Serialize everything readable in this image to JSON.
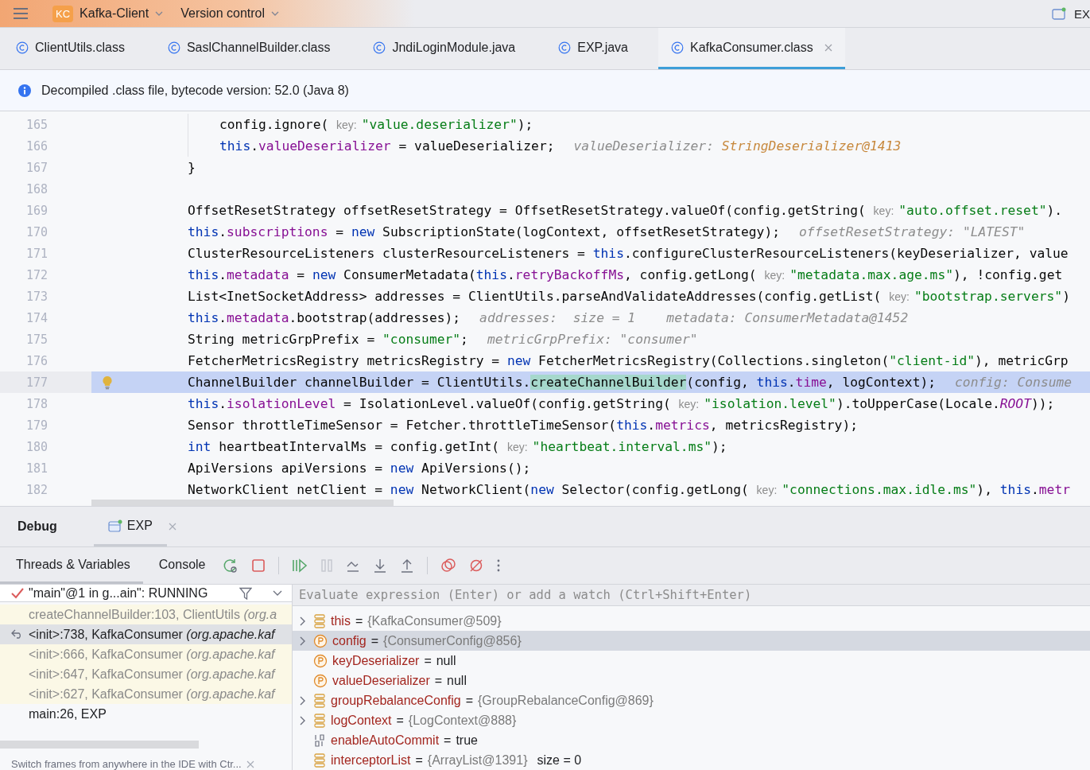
{
  "title_bar": {
    "project_badge": "KC",
    "project": "Kafka-Client",
    "vcs": "Version control",
    "right_label": "EX"
  },
  "tabs": [
    {
      "label": "ClientUtils.class",
      "selected": false
    },
    {
      "label": "SaslChannelBuilder.class",
      "selected": false
    },
    {
      "label": "JndiLoginModule.java",
      "selected": false
    },
    {
      "label": "EXP.java",
      "selected": false
    },
    {
      "label": "KafkaConsumer.class",
      "selected": true
    }
  ],
  "info_bar": "Decompiled .class file, bytecode version: 52.0 (Java 8)",
  "editor": {
    "lines": [
      {
        "number": "165",
        "nested": true,
        "current": false,
        "bulb": false,
        "tokens": [
          {
            "kind": "plain",
            "text": "config.ignore( "
          },
          {
            "kind": "hint",
            "text": "key:"
          },
          {
            "kind": "string",
            "text": "\"value.deserializer\""
          },
          {
            "kind": "plain",
            "text": ");"
          }
        ]
      },
      {
        "number": "166",
        "nested": true,
        "current": false,
        "bulb": false,
        "tokens": [
          {
            "kind": "keyword",
            "text": "this"
          },
          {
            "kind": "plain",
            "text": "."
          },
          {
            "kind": "field",
            "text": "valueDeserializer"
          },
          {
            "kind": "plain",
            "text": " = valueDeserializer;"
          },
          {
            "kind": "inline",
            "text": "valueDeserializer: "
          },
          {
            "kind": "inline_value",
            "text": "StringDeserializer@1413"
          }
        ]
      },
      {
        "number": "167",
        "nested": false,
        "current": false,
        "bulb": false,
        "tokens": [
          {
            "kind": "plain",
            "text": "}"
          }
        ]
      },
      {
        "number": "168",
        "nested": false,
        "current": false,
        "bulb": false
      },
      {
        "number": "169",
        "nested": false,
        "current": false,
        "bulb": false,
        "tokens": [
          {
            "kind": "plain",
            "text": "OffsetResetStrategy offsetResetStrategy = OffsetResetStrategy.valueOf(config.getString( "
          },
          {
            "kind": "hint",
            "text": "key:"
          },
          {
            "kind": "string",
            "text": "\"auto.offset.reset\""
          },
          {
            "kind": "plain",
            "text": ")."
          }
        ]
      },
      {
        "number": "170",
        "nested": false,
        "current": false,
        "bulb": false,
        "tokens": [
          {
            "kind": "keyword",
            "text": "this"
          },
          {
            "kind": "plain",
            "text": "."
          },
          {
            "kind": "field",
            "text": "subscriptions"
          },
          {
            "kind": "plain",
            "text": " = "
          },
          {
            "kind": "keyword",
            "text": "new"
          },
          {
            "kind": "plain",
            "text": " SubscriptionState(logContext, offsetResetStrategy);"
          },
          {
            "kind": "inline",
            "text": "offsetResetStrategy: \"LATEST\""
          }
        ]
      },
      {
        "number": "171",
        "nested": false,
        "current": false,
        "bulb": false,
        "tokens": [
          {
            "kind": "plain",
            "text": "ClusterResourceListeners clusterResourceListeners = "
          },
          {
            "kind": "keyword",
            "text": "this"
          },
          {
            "kind": "plain",
            "text": ".configureClusterResourceListeners(keyDeserializer, value"
          }
        ]
      },
      {
        "number": "172",
        "nested": false,
        "current": false,
        "bulb": false,
        "tokens": [
          {
            "kind": "keyword",
            "text": "this"
          },
          {
            "kind": "plain",
            "text": "."
          },
          {
            "kind": "field",
            "text": "metadata"
          },
          {
            "kind": "plain",
            "text": " = "
          },
          {
            "kind": "keyword",
            "text": "new"
          },
          {
            "kind": "plain",
            "text": " ConsumerMetadata("
          },
          {
            "kind": "keyword",
            "text": "this"
          },
          {
            "kind": "plain",
            "text": "."
          },
          {
            "kind": "field",
            "text": "retryBackoffMs"
          },
          {
            "kind": "plain",
            "text": ", config.getLong( "
          },
          {
            "kind": "hint",
            "text": "key:"
          },
          {
            "kind": "string",
            "text": "\"metadata.max.age.ms\""
          },
          {
            "kind": "plain",
            "text": "), !config.get"
          }
        ]
      },
      {
        "number": "173",
        "nested": false,
        "current": false,
        "bulb": false,
        "tokens": [
          {
            "kind": "plain",
            "text": "List<InetSocketAddress> addresses = ClientUtils.parseAndValidateAddresses(config.getList( "
          },
          {
            "kind": "hint",
            "text": "key:"
          },
          {
            "kind": "string",
            "text": "\"bootstrap.servers\""
          },
          {
            "kind": "plain",
            "text": ")"
          }
        ]
      },
      {
        "number": "174",
        "nested": false,
        "current": false,
        "bulb": false,
        "tokens": [
          {
            "kind": "keyword",
            "text": "this"
          },
          {
            "kind": "plain",
            "text": "."
          },
          {
            "kind": "field",
            "text": "metadata"
          },
          {
            "kind": "plain",
            "text": ".bootstrap(addresses);"
          },
          {
            "kind": "inline",
            "text": "addresses:  size = 1    metadata: ConsumerMetadata@1452"
          }
        ]
      },
      {
        "number": "175",
        "nested": false,
        "current": false,
        "bulb": false,
        "tokens": [
          {
            "kind": "plain",
            "text": "String metricGrpPrefix = "
          },
          {
            "kind": "string",
            "text": "\"consumer\""
          },
          {
            "kind": "plain",
            "text": ";"
          },
          {
            "kind": "inline",
            "text": "metricGrpPrefix: \"consumer\""
          }
        ]
      },
      {
        "number": "176",
        "nested": false,
        "current": false,
        "bulb": false,
        "tokens": [
          {
            "kind": "plain",
            "text": "FetcherMetricsRegistry metricsRegistry = "
          },
          {
            "kind": "keyword",
            "text": "new"
          },
          {
            "kind": "plain",
            "text": " FetcherMetricsRegistry(Collections.singleton("
          },
          {
            "kind": "string",
            "text": "\"client-id\""
          },
          {
            "kind": "plain",
            "text": "), metricGrp"
          }
        ]
      },
      {
        "number": "177",
        "nested": false,
        "current": true,
        "bulb": true,
        "tokens": [
          {
            "kind": "plain",
            "text": "ChannelBuilder channelBuilder = ClientUtils."
          },
          {
            "kind": "match",
            "text": "createChannelBuilder"
          },
          {
            "kind": "plain",
            "text": "(config, "
          },
          {
            "kind": "keyword",
            "text": "this"
          },
          {
            "kind": "plain",
            "text": "."
          },
          {
            "kind": "field",
            "text": "time"
          },
          {
            "kind": "plain",
            "text": ", logContext);"
          },
          {
            "kind": "inline",
            "text": "config: Consume"
          }
        ]
      },
      {
        "number": "178",
        "nested": false,
        "current": false,
        "bulb": false,
        "tokens": [
          {
            "kind": "keyword",
            "text": "this"
          },
          {
            "kind": "plain",
            "text": "."
          },
          {
            "kind": "field",
            "text": "isolationLevel"
          },
          {
            "kind": "plain",
            "text": " = IsolationLevel.valueOf(config.getString( "
          },
          {
            "kind": "hint",
            "text": "key:"
          },
          {
            "kind": "string",
            "text": "\"isolation.level\""
          },
          {
            "kind": "plain",
            "text": ").toUpperCase(Locale."
          },
          {
            "kind": "constant",
            "text": "ROOT"
          },
          {
            "kind": "plain",
            "text": "));"
          }
        ]
      },
      {
        "number": "179",
        "nested": false,
        "current": false,
        "bulb": false,
        "tokens": [
          {
            "kind": "plain",
            "text": "Sensor throttleTimeSensor = Fetcher.throttleTimeSensor("
          },
          {
            "kind": "keyword",
            "text": "this"
          },
          {
            "kind": "plain",
            "text": "."
          },
          {
            "kind": "field",
            "text": "metrics"
          },
          {
            "kind": "plain",
            "text": ", metricsRegistry);"
          }
        ]
      },
      {
        "number": "180",
        "nested": false,
        "current": false,
        "bulb": false,
        "tokens": [
          {
            "kind": "keyword",
            "text": "int"
          },
          {
            "kind": "plain",
            "text": " heartbeatIntervalMs = config.getInt( "
          },
          {
            "kind": "hint",
            "text": "key:"
          },
          {
            "kind": "string",
            "text": "\"heartbeat.interval.ms\""
          },
          {
            "kind": "plain",
            "text": ");"
          }
        ]
      },
      {
        "number": "181",
        "nested": false,
        "current": false,
        "bulb": false,
        "tokens": [
          {
            "kind": "plain",
            "text": "ApiVersions apiVersions = "
          },
          {
            "kind": "keyword",
            "text": "new"
          },
          {
            "kind": "plain",
            "text": " ApiVersions();"
          }
        ]
      },
      {
        "number": "182",
        "nested": false,
        "current": false,
        "bulb": false,
        "tokens": [
          {
            "kind": "plain",
            "text": "NetworkClient netClient = "
          },
          {
            "kind": "keyword",
            "text": "new"
          },
          {
            "kind": "plain",
            "text": " NetworkClient("
          },
          {
            "kind": "keyword",
            "text": "new"
          },
          {
            "kind": "plain",
            "text": " Selector(config.getLong( "
          },
          {
            "kind": "hint",
            "text": "key:"
          },
          {
            "kind": "string",
            "text": "\"connections.max.idle.ms\""
          },
          {
            "kind": "plain",
            "text": "), "
          },
          {
            "kind": "keyword",
            "text": "this"
          },
          {
            "kind": "plain",
            "text": "."
          },
          {
            "kind": "field",
            "text": "metr"
          }
        ]
      }
    ]
  },
  "debug": {
    "title": "Debug",
    "session_tab": "EXP",
    "subtabs": [
      {
        "label": "Threads & Variables",
        "selected": true
      },
      {
        "label": "Console",
        "selected": false
      }
    ],
    "thread": "\"main\"@1 in g...ain\": RUNNING",
    "frames": [
      {
        "text": "createChannelBuilder:103, ClientUtils *(org.a*",
        "library": true,
        "selected": false
      },
      {
        "text": "<init>:738, KafkaConsumer *(org.apache.kaf*",
        "library": true,
        "selected": true
      },
      {
        "text": "<init>:666, KafkaConsumer *(org.apache.kaf*",
        "library": true,
        "selected": false
      },
      {
        "text": "<init>:647, KafkaConsumer *(org.apache.kaf*",
        "library": true,
        "selected": false
      },
      {
        "text": "<init>:627, KafkaConsumer *(org.apache.kaf*",
        "library": true,
        "selected": false
      },
      {
        "text": "main:26, EXP",
        "library": false,
        "selected": false
      }
    ],
    "frames_hint": "Switch frames from anywhere in the IDE with Ctr...",
    "evaluate_placeholder": "Evaluate expression (Enter) or add a watch (Ctrl+Shift+Enter)",
    "variables": [
      {
        "kind": "field",
        "name": "this",
        "operator": "=",
        "value": "{KafkaConsumer@509}",
        "ref": true,
        "expandable": true,
        "selected": false
      },
      {
        "kind": "param",
        "name": "config",
        "operator": "=",
        "value": "{ConsumerConfig@856}",
        "ref": true,
        "expandable": true,
        "selected": true
      },
      {
        "kind": "param",
        "name": "keyDeserializer",
        "operator": "=",
        "value": "null",
        "ref": false,
        "expandable": false,
        "selected": false
      },
      {
        "kind": "param",
        "name": "valueDeserializer",
        "operator": "=",
        "value": "null",
        "ref": false,
        "expandable": false,
        "selected": false
      },
      {
        "kind": "field",
        "name": "groupRebalanceConfig",
        "operator": "=",
        "value": "{GroupRebalanceConfig@869}",
        "ref": true,
        "expandable": true,
        "selected": false
      },
      {
        "kind": "field",
        "name": "logContext",
        "operator": "=",
        "value": "{LogContext@888}",
        "ref": true,
        "expandable": true,
        "selected": false
      },
      {
        "kind": "primitive",
        "name": "enableAutoCommit",
        "operator": "=",
        "value": "true",
        "ref": false,
        "expandable": false,
        "selected": false
      },
      {
        "kind": "field",
        "name": "interceptorList",
        "operator": "=",
        "value": "{ArrayList@1391}",
        "ref": true,
        "expandable": false,
        "selected": false,
        "extra": "size = 0"
      }
    ]
  }
}
